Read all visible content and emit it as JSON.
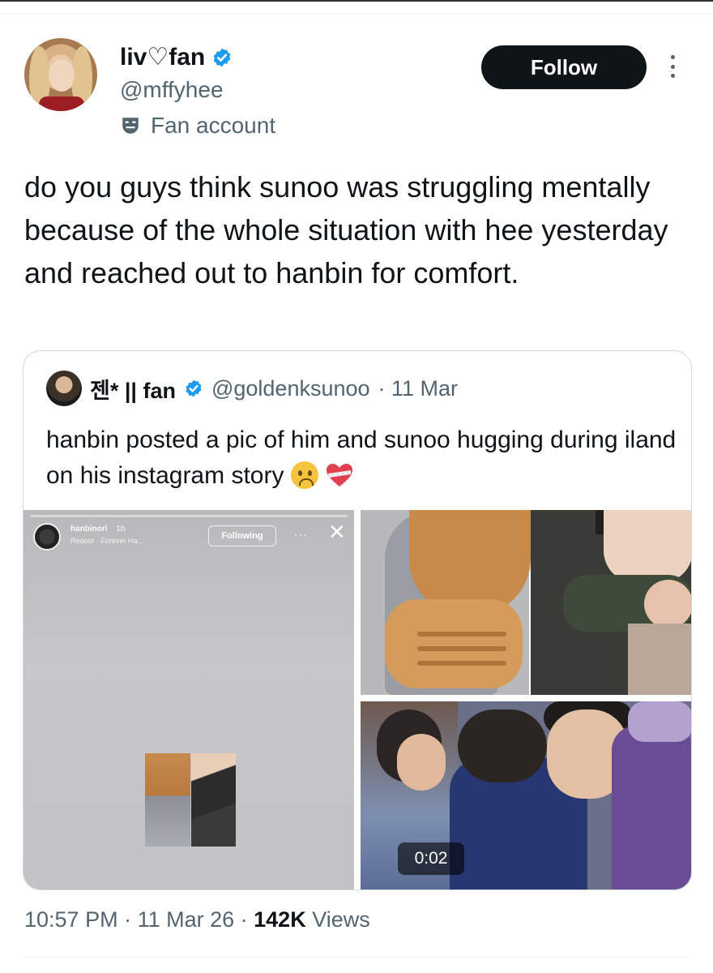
{
  "author": {
    "display_name": "liv♡fan",
    "handle": "@mffyhee",
    "badge_label": "Fan account",
    "verified": true,
    "verified_color": "#1d9bf0"
  },
  "actions": {
    "follow_label": "Follow",
    "more_icon": "more-vertical-icon"
  },
  "tweet": {
    "text": "do you guys think sunoo was struggling mentally because of the whole situation with hee yesterday and reached out to hanbin for comfort."
  },
  "quote": {
    "display_name": "젠* || fan",
    "handle": "@goldenksunoo",
    "date": "· 11 Mar",
    "text": "hanbin posted a pic of him and sunoo hugging during iland on his instagram story",
    "emojis": [
      "worried-face-emoji",
      "mending-heart-emoji"
    ],
    "media": {
      "story": {
        "username": "hanbinori",
        "age": "1h",
        "song": "Redoor · Forever Ha...",
        "follow_label": "Following",
        "dots": "···",
        "close": "✕"
      },
      "video_time": "0:02"
    }
  },
  "meta": {
    "time": "10:57 PM",
    "sep1": " · ",
    "date": "11 Mar 26",
    "sep2": " · ",
    "views_count": "142K",
    "views_label": " Views"
  },
  "colors": {
    "text": "#0f1419",
    "secondary": "#536471",
    "border": "#cfd9de",
    "follow_bg": "#0f1419"
  }
}
